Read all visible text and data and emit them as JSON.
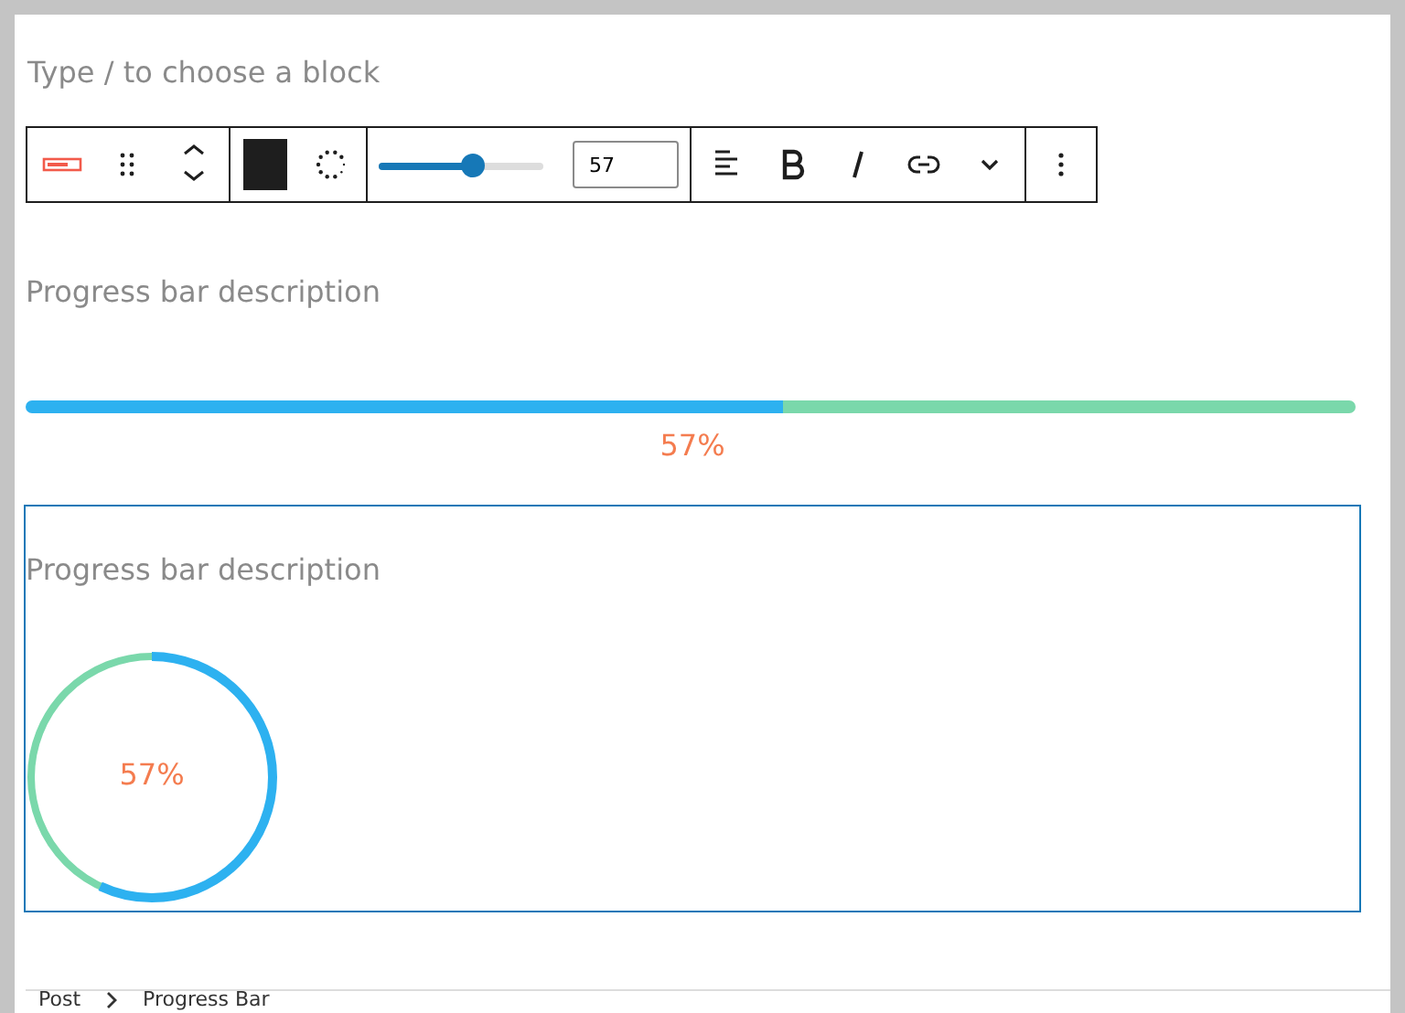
{
  "editor": {
    "placeholder": "Type / to choose a block"
  },
  "toolbar": {
    "slider": {
      "level": 0.57
    },
    "value": "57"
  },
  "blocks": [
    {
      "kind": "linear",
      "description": "Progress bar description",
      "level": 0.57,
      "label": "57%",
      "selected": false
    },
    {
      "kind": "circle",
      "description": "Progress bar description",
      "level": 0.57,
      "label": "57%",
      "selected": true
    }
  ],
  "breadcrumb": [
    "Post",
    "Progress Bar"
  ]
}
